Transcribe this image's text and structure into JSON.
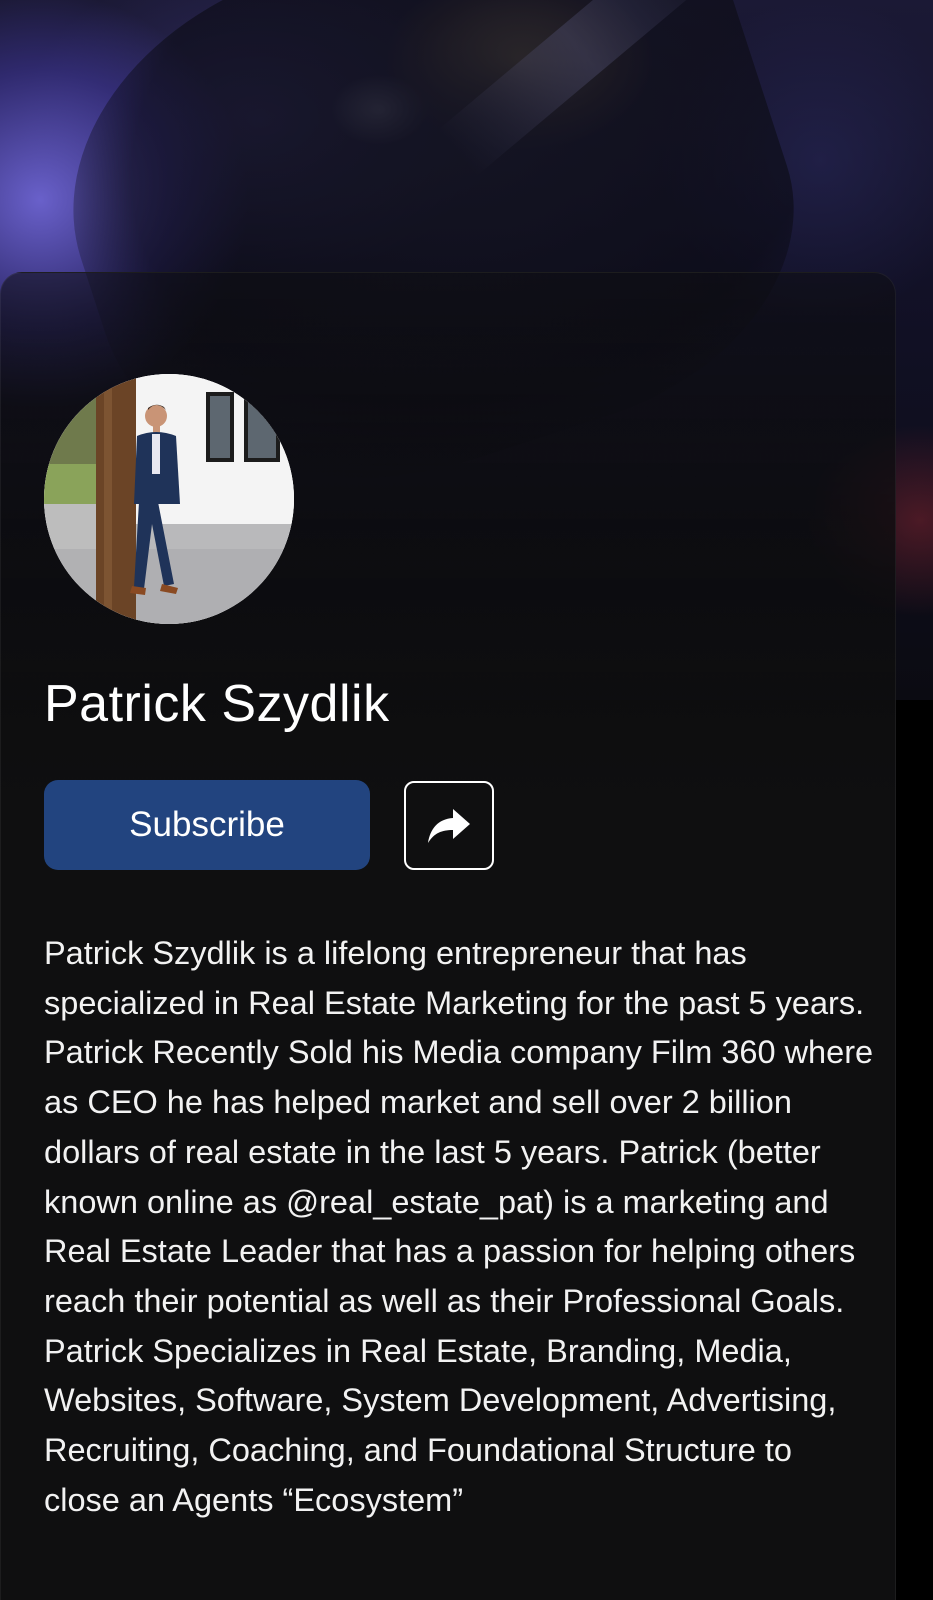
{
  "profile": {
    "name": "Patrick Szydlik",
    "avatar_alt": "Patrick Szydlik profile photo",
    "bio": "Patrick Szydlik is a lifelong entrepreneur that has specialized in Real Estate Marketing for the past 5 years. Patrick Recently Sold his Media company Film 360 where as CEO he has helped market and sell over 2 billion dollars of real estate in the last 5 years. Patrick (better known online as @real_estate_pat) is a marketing and Real Estate Leader that has a passion for helping others reach their potential as well as their Professional Goals. Patrick Specializes in Real Estate, Branding, Media, Websites, Software, System Development, Advertising, Recruiting, Coaching, and Foundational Structure to close an Agents “Ecosystem”"
  },
  "actions": {
    "subscribe_label": "Subscribe",
    "share_icon": "share-arrow-icon"
  },
  "colors": {
    "subscribe_bg": "#22447f",
    "card_bg": "#0f0f10",
    "text": "#ffffff"
  }
}
